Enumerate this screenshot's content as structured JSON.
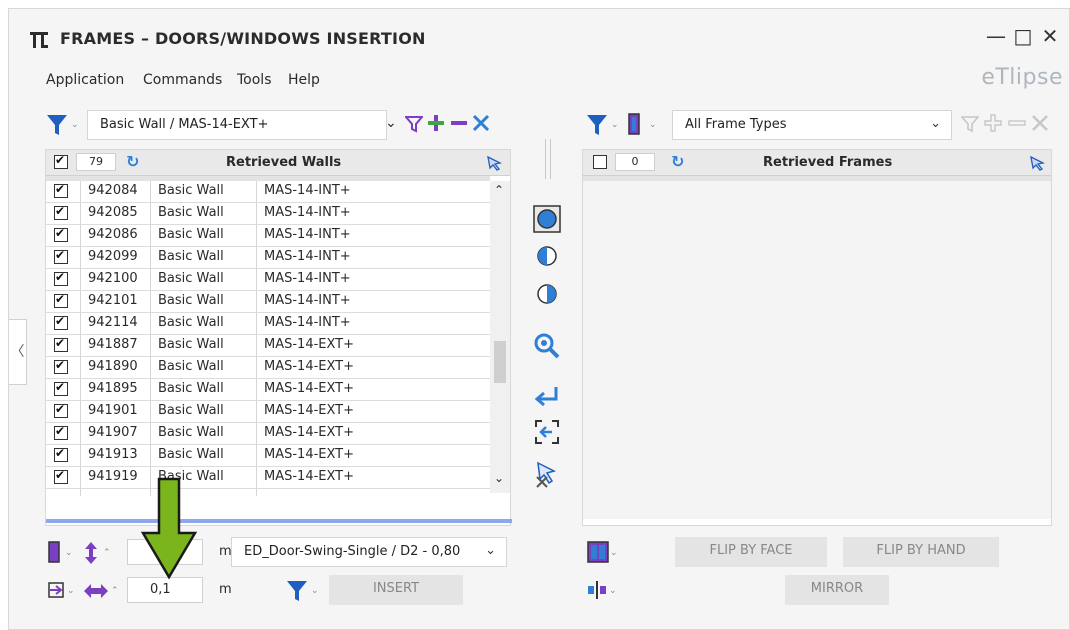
{
  "window": {
    "title": "FRAMES – DOORS/WINDOWS INSERTION",
    "brand": "eTlipse",
    "controls": {
      "minimize": "—",
      "maximize": "□",
      "close": "✕"
    }
  },
  "menu": {
    "items": [
      "Application",
      "Commands",
      "Tools",
      "Help"
    ]
  },
  "left_panel": {
    "filter_value": "Basic Wall / MAS-14-EXT+",
    "header_count": "79",
    "header_title": "Retrieved Walls",
    "rows": [
      {
        "id": "942084",
        "family": "Basic Wall",
        "type": "MAS-14-INT+",
        "checked": true
      },
      {
        "id": "942085",
        "family": "Basic Wall",
        "type": "MAS-14-INT+",
        "checked": true
      },
      {
        "id": "942086",
        "family": "Basic Wall",
        "type": "MAS-14-INT+",
        "checked": true
      },
      {
        "id": "942099",
        "family": "Basic Wall",
        "type": "MAS-14-INT+",
        "checked": true
      },
      {
        "id": "942100",
        "family": "Basic Wall",
        "type": "MAS-14-INT+",
        "checked": true
      },
      {
        "id": "942101",
        "family": "Basic Wall",
        "type": "MAS-14-INT+",
        "checked": true
      },
      {
        "id": "942114",
        "family": "Basic Wall",
        "type": "MAS-14-INT+",
        "checked": true
      },
      {
        "id": "941887",
        "family": "Basic Wall",
        "type": "MAS-14-EXT+",
        "checked": true
      },
      {
        "id": "941890",
        "family": "Basic Wall",
        "type": "MAS-14-EXT+",
        "checked": true
      },
      {
        "id": "941895",
        "family": "Basic Wall",
        "type": "MAS-14-EXT+",
        "checked": true
      },
      {
        "id": "941901",
        "family": "Basic Wall",
        "type": "MAS-14-EXT+",
        "checked": true
      },
      {
        "id": "941907",
        "family": "Basic Wall",
        "type": "MAS-14-EXT+",
        "checked": true
      },
      {
        "id": "941913",
        "family": "Basic Wall",
        "type": "MAS-14-EXT+",
        "checked": true
      },
      {
        "id": "941919",
        "family": "Basic Wall",
        "type": "MAS-14-EXT+",
        "checked": true
      }
    ]
  },
  "right_panel": {
    "filter_value": "All Frame Types",
    "header_count": "0",
    "header_title": "Retrieved Frames"
  },
  "bottom_left": {
    "unit_1": "m",
    "unit_2": "m",
    "offset_value": "0,1",
    "door_type": "ED_Door-Swing-Single / D2 - 0,80",
    "insert_label": "INSERT"
  },
  "bottom_right": {
    "flip_face_label": "FLIP BY FACE",
    "flip_hand_label": "FLIP BY HAND",
    "mirror_label": "MIRROR"
  },
  "side_tab": {
    "label": "〈"
  },
  "colors": {
    "accent_blue": "#2f7fd6",
    "filter_blue": "#1f5fbf",
    "filter_purple": "#7b3fc4",
    "plus_green": "#3aa83a",
    "arrow_green": "#7ab51d",
    "selection_bar": "#8ea8ee"
  }
}
